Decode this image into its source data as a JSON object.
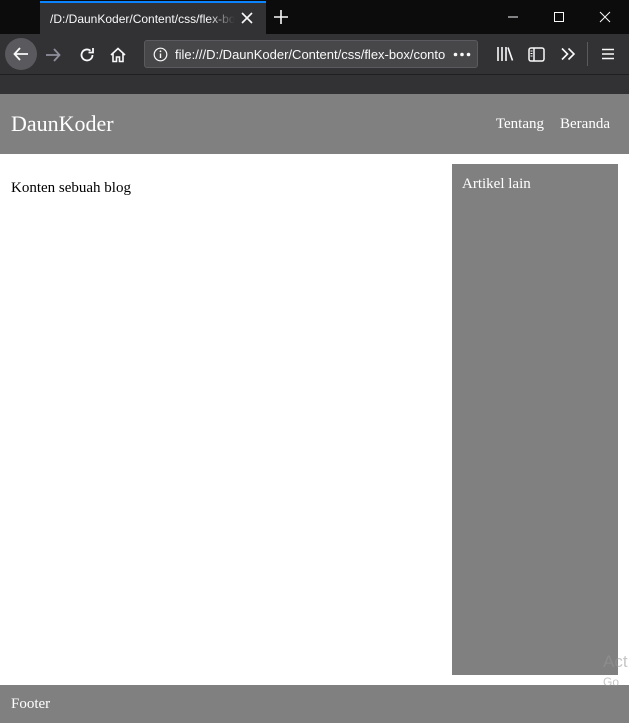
{
  "browser": {
    "tab_title": "/D:/DaunKoder/Content/css/flex-box/contoh.html",
    "url": "file:///D:/DaunKoder/Content/css/flex-box/contoh.html"
  },
  "page": {
    "header": {
      "logo": "DaunKoder",
      "menu": [
        "Tentang",
        "Beranda"
      ]
    },
    "main": {
      "text": "Konten sebuah blog"
    },
    "aside": {
      "title": "Artikel lain"
    },
    "footer": {
      "text": "Footer"
    }
  },
  "overlay": {
    "watermark_line1": "Act",
    "watermark_line2": "Go"
  },
  "colors": {
    "header_bg": "#808080",
    "chrome_dark": "#0c0c0d",
    "chrome_toolbar": "#323234",
    "tab_accent": "#0a84ff"
  }
}
